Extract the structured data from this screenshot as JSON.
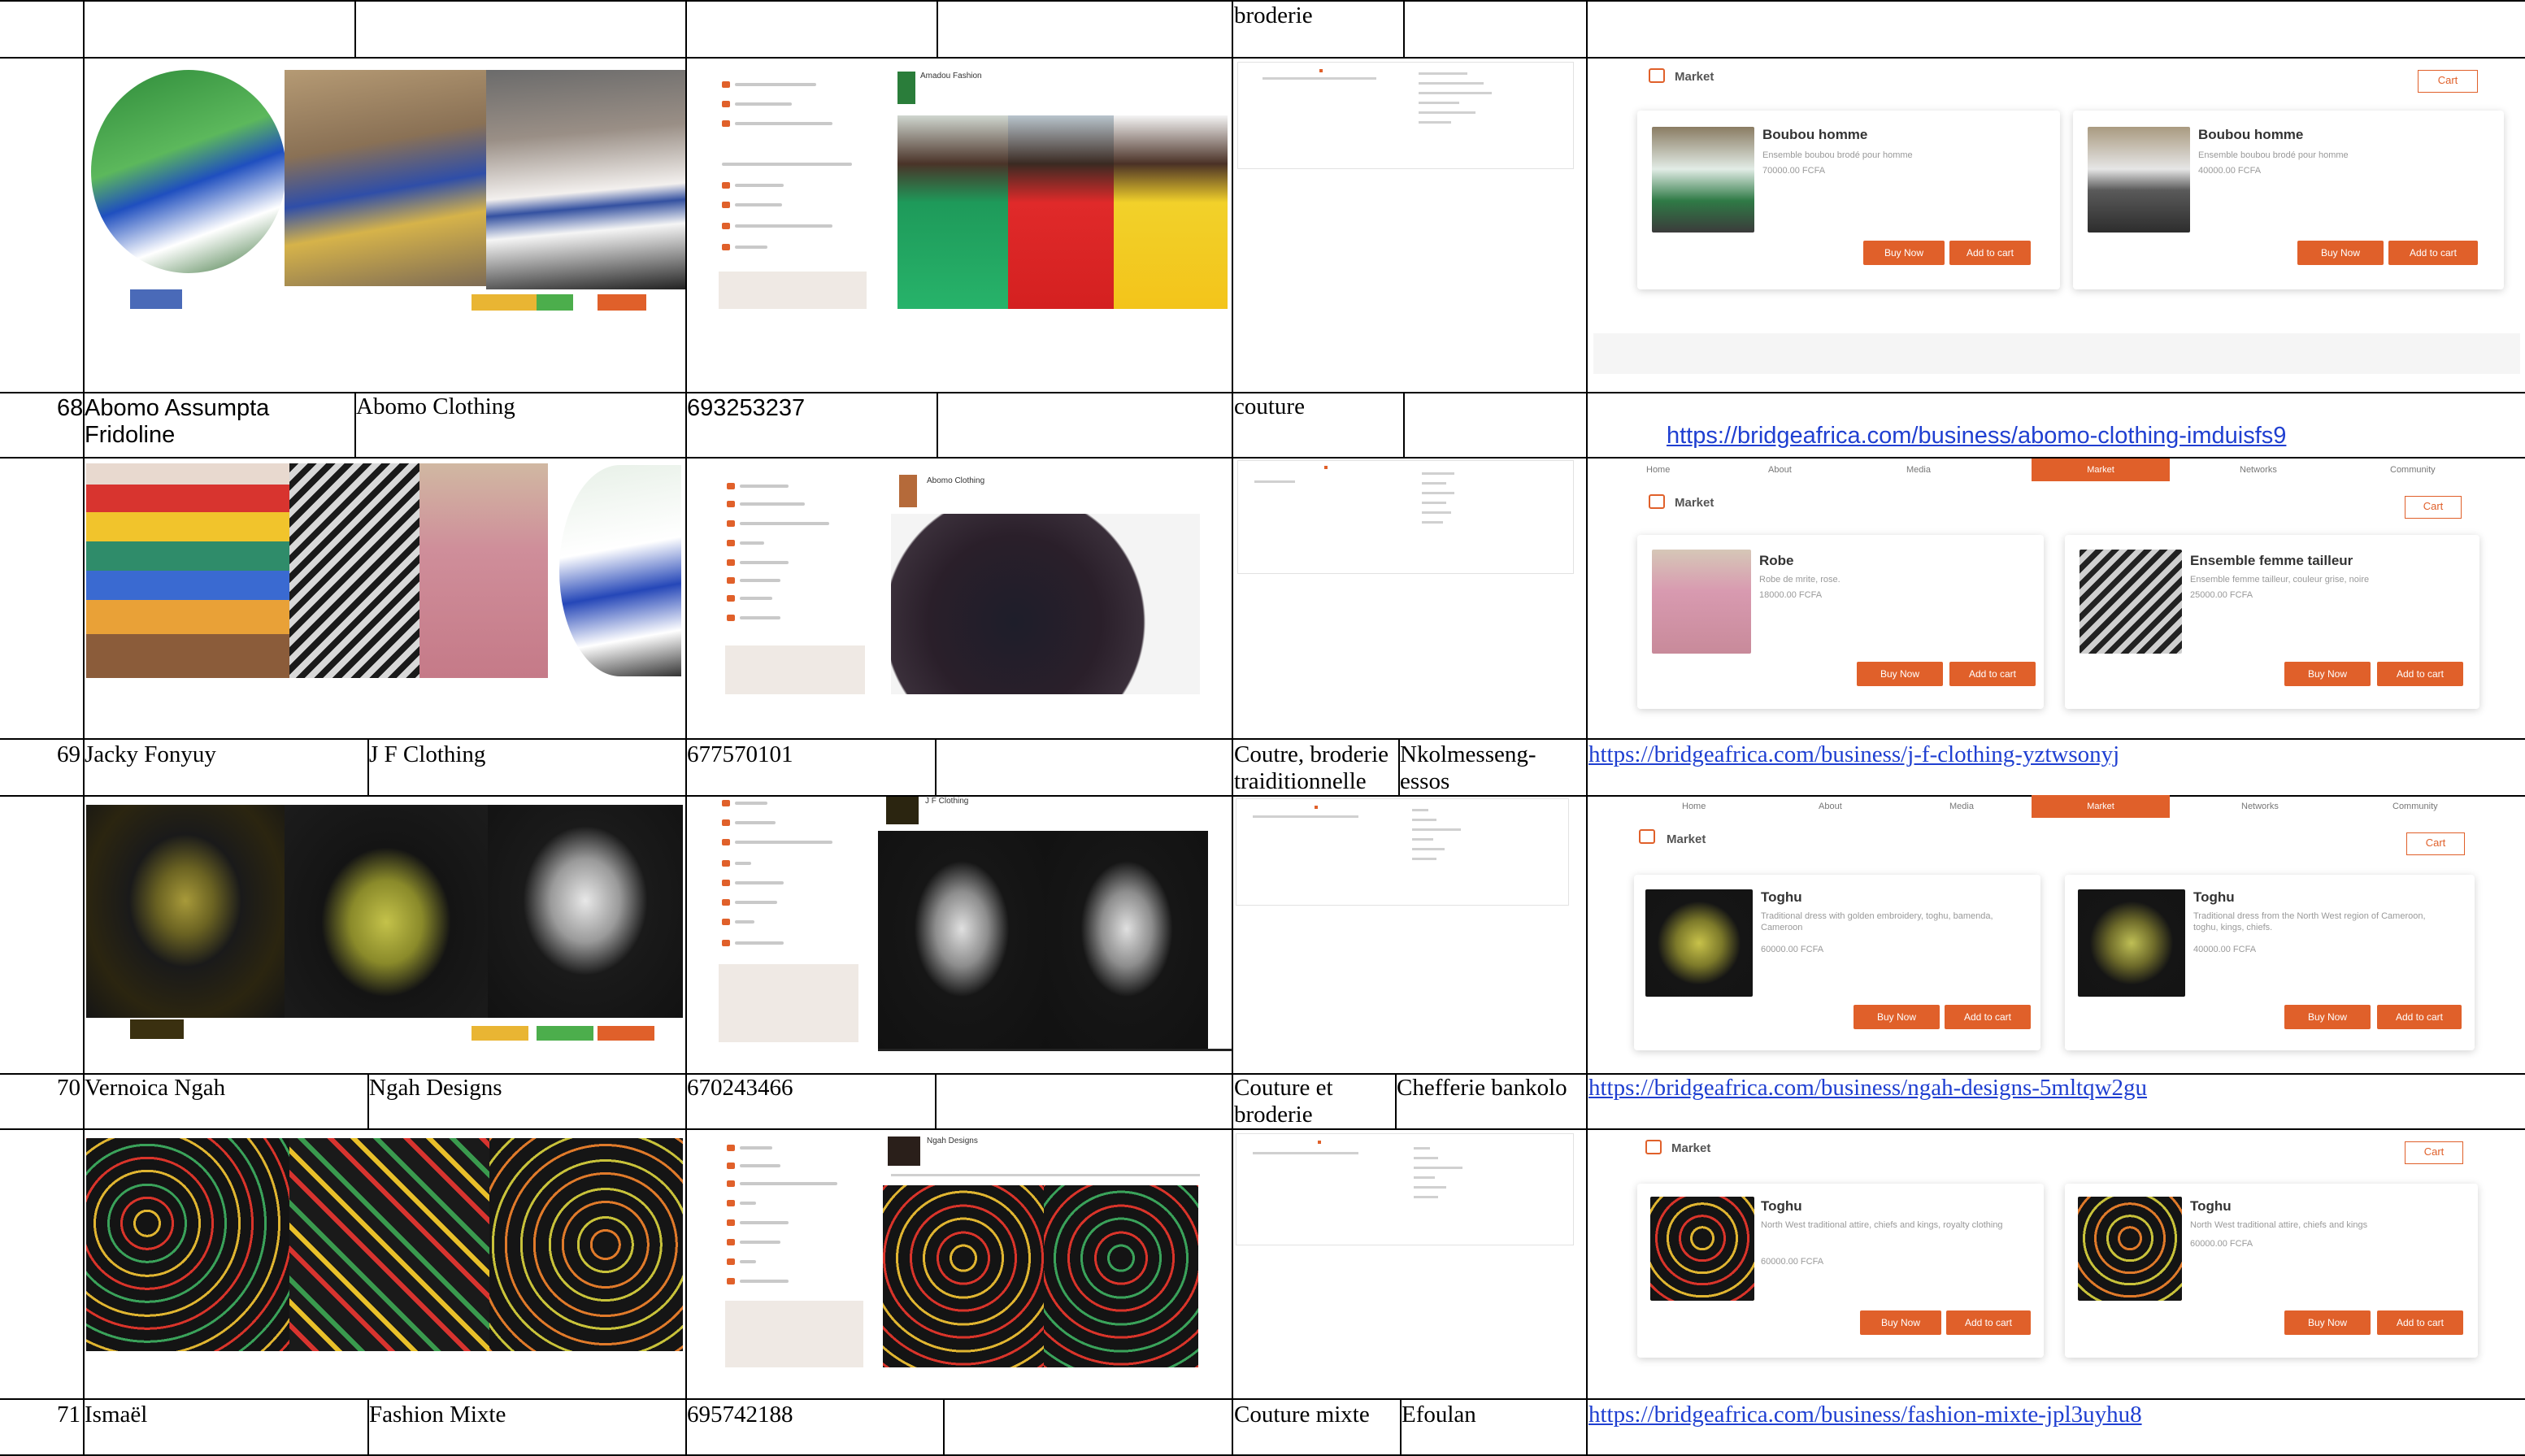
{
  "table": {
    "top_row": {
      "activity": "broderie"
    },
    "rows": [
      {
        "num": "68",
        "name": "Abomo Assumpta Fridoline",
        "business": "Abomo Clothing",
        "phone": "693253237",
        "activity": "couture",
        "location": "",
        "url": "https://bridgeafrica.com/business/abomo-clothing-imduisfs9"
      },
      {
        "num": "69",
        "name": "Jacky Fonyuy",
        "business": "J F Clothing",
        "phone": "677570101",
        "activity": "Coutre, broderie traiditionnelle",
        "location": "Nkolmesseng-essos",
        "url": "https://bridgeafrica.com/business/j-f-clothing-yztwsonyj"
      },
      {
        "num": "70",
        "name": "Vernoica Ngah",
        "business": "Ngah Designs",
        "phone": "670243466",
        "activity": "Couture et broderie",
        "location": "Chefferie bankolo",
        "url": "https://bridgeafrica.com/business/ngah-designs-5mltqw2gu"
      },
      {
        "num": "71",
        "name": "Ismaël",
        "business": "Fashion Mixte",
        "phone": "695742188",
        "activity": "Couture mixte",
        "location": "Efoulan",
        "url": "https://bridgeafrica.com/business/fashion-mixte-jpl3uyhu8"
      }
    ]
  },
  "market": {
    "title": "Market",
    "cart_label": "Cart",
    "buy_label": "Buy Now",
    "add_label": "Add to cart",
    "nav": [
      "Home",
      "About",
      "Media",
      "Market",
      "Networks",
      "Community"
    ],
    "blocks": [
      {
        "products": [
          {
            "name": "Boubou homme",
            "desc": "Ensemble boubou brodé pour homme",
            "price": "70000.00 FCFA"
          },
          {
            "name": "Boubou homme",
            "desc": "Ensemble boubou brodé pour homme",
            "price": "40000.00 FCFA"
          }
        ]
      },
      {
        "products": [
          {
            "name": "Robe",
            "desc": "Robe de mrite, rose.",
            "price": "18000.00 FCFA"
          },
          {
            "name": "Ensemble femme tailleur",
            "desc": "Ensemble femme tailleur, couleur grise, noire",
            "price": "25000.00 FCFA"
          }
        ]
      },
      {
        "products": [
          {
            "name": "Toghu",
            "desc": "Traditional dress with golden embroidery, toghu, bamenda, Cameroon",
            "price": "60000.00 FCFA"
          },
          {
            "name": "Toghu",
            "desc": "Traditional dress from the North West region of Cameroon, toghu, kings, chiefs.",
            "price": "40000.00 FCFA"
          }
        ]
      },
      {
        "products": [
          {
            "name": "Toghu",
            "desc": "North West traditional attire, chiefs and kings, royalty clothing",
            "price": "60000.00 FCFA"
          },
          {
            "name": "Toghu",
            "desc": "North West traditional attire, chiefs and kings",
            "price": "60000.00 FCFA"
          }
        ]
      }
    ]
  },
  "profiles": [
    {
      "business": "Amadou Fashion"
    },
    {
      "business": "Abomo Clothing"
    },
    {
      "business": "J F Clothing"
    },
    {
      "business": "Ngah Designs"
    }
  ],
  "colors": {
    "accent": "#e0602a",
    "link": "#1f3fd1",
    "grid": "#000000"
  }
}
